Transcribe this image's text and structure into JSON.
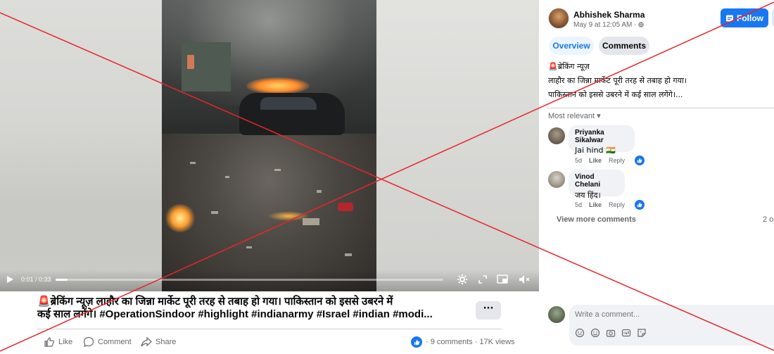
{
  "video": {
    "time": "0:01 / 0:33",
    "progress": 0.03
  },
  "post": {
    "caption_line1": "🚨ब्रेकिंग न्यूज़ लाहौर का जिन्ना मार्केट पूरी तरह से तबाह हो गया। पाकिस्तान को इससे उबरने में",
    "caption_line2": "कई साल लगेंगे। #OperationSindoor #highlight #indianarmy #Israel #indian #modi...",
    "more": "···",
    "actions": {
      "like": "Like",
      "comment": "Comment",
      "share": "Share"
    },
    "stats": "· 9 comments · 17K views"
  },
  "panel": {
    "author": "Abhishek Sharma",
    "date": "May 9 at 12:05 AM · ",
    "follow": "Follow",
    "tabs": {
      "overview": "Overview",
      "comments": "Comments"
    },
    "text_line1": "🚨ब्रेकिंग न्यूज़",
    "text_line2": "लाहौर का जिन्ना मार्केट पूरी तरह से तबाह हो गया।",
    "text_line3": "पाकिस्तान को इससे उबरने में कई साल लगेंगे।...",
    "sort": "Most relevant ▾",
    "comments": [
      {
        "name": "Priyanka Sikalwar",
        "text": "Jai hind 🇮🇳",
        "age": "5d",
        "like": "Like",
        "reply": "Reply"
      },
      {
        "name": "Vinod Chelani",
        "text": "जय हिंद।",
        "age": "5d",
        "like": "Like",
        "reply": "Reply"
      }
    ],
    "view_more": "View more comments",
    "count": "2 o",
    "write_placeholder": "Write a comment..."
  },
  "colors": {
    "accent": "#1877f2",
    "overlay_red": "#e8242b"
  }
}
